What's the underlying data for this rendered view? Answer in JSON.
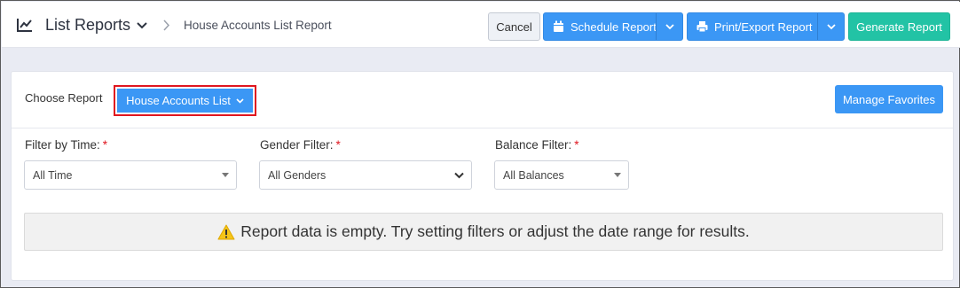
{
  "header": {
    "title": "List Reports",
    "breadcrumb": "House Accounts List Report",
    "icons": {
      "title": "line-chart-icon",
      "caret": "chevron-down-icon",
      "separator": "chevron-right-icon"
    }
  },
  "toolbar": {
    "cancel_label": "Cancel",
    "schedule_label": "Schedule Report",
    "print_label": "Print/Export Report",
    "generate_label": "Generate Report"
  },
  "report_picker": {
    "label": "Choose Report",
    "selected": "House Accounts List",
    "manage_favorites_label": "Manage Favorites"
  },
  "filters": [
    {
      "label": "Filter by Time:",
      "required_mark": "*",
      "value": "All Time"
    },
    {
      "label": "Gender Filter:",
      "required_mark": "*",
      "value": "All Genders"
    },
    {
      "label": "Balance Filter:",
      "required_mark": "*",
      "value": "All Balances"
    }
  ],
  "alert": {
    "message": "Report data is empty. Try setting filters or adjust the date range for results.",
    "icon": "warning-icon"
  },
  "colors": {
    "primary": "#3b97f5",
    "success": "#22c3a5",
    "highlight_border": "#e0161f",
    "background": "#e9ebf3",
    "warning": "#f5c518"
  }
}
